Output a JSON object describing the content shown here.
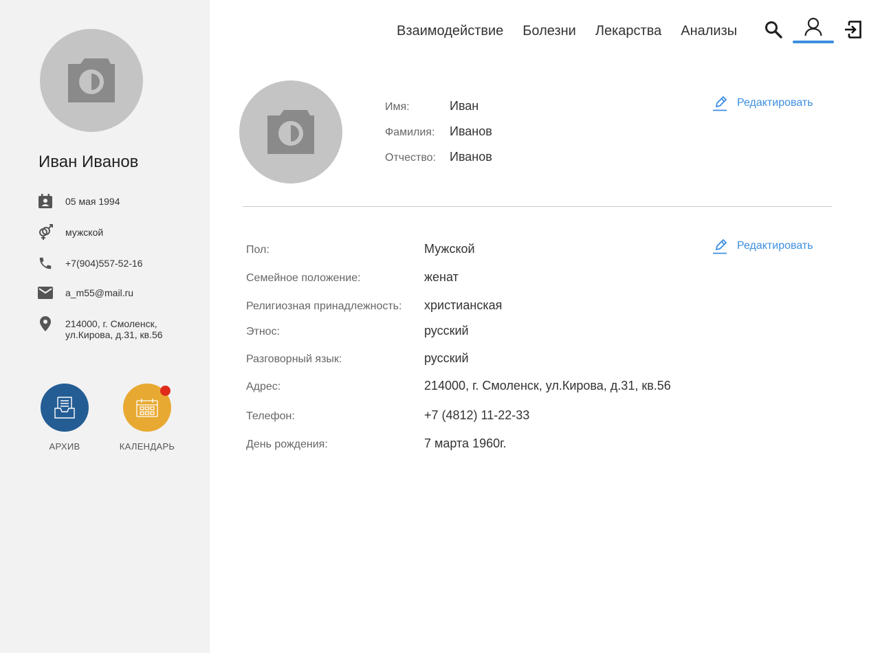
{
  "sidebar": {
    "name": "Иван Иванов",
    "birthdate": "05 мая 1994",
    "gender": "мужской",
    "phone": "+7(904)557-52-16",
    "email": "a_m55@mail.ru",
    "address_line1": "214000, г. Смоленск,",
    "address_line2": "ул.Кирова, д.31, кв.56",
    "archive_label": "АРХИВ",
    "calendar_label": "КАЛЕНДАРЬ"
  },
  "nav": {
    "items": [
      "Взаимодействие",
      "Болезни",
      "Лекарства",
      "Анализы"
    ],
    "icons": [
      "search-icon",
      "user-icon",
      "logout-icon"
    ]
  },
  "profile": {
    "fields": [
      {
        "label": "Имя:",
        "value": "Иван"
      },
      {
        "label": "Фамилия:",
        "value": "Иванов"
      },
      {
        "label": "Отчество:",
        "value": "Иванов"
      }
    ],
    "edit_label": "Редактировать"
  },
  "details": {
    "edit_label": "Редактировать",
    "rows": [
      {
        "label": "Пол:",
        "value": "Мужской"
      },
      {
        "label": "Семейное положение:",
        "value": "женат"
      },
      {
        "label": "Религиозная принадлежность:",
        "value": "христианская"
      },
      {
        "label": "Этнос:",
        "value": "русский"
      },
      {
        "label": "Разговорный язык:",
        "value": "русский"
      },
      {
        "label": "Адрес:",
        "value": "214000, г. Смоленск, ул.Кирова, д.31, кв.56"
      },
      {
        "label": "Телефон:",
        "value": "+7 (4812) 11-22-33"
      },
      {
        "label": "День рождения:",
        "value": "7 марта 1960г."
      }
    ]
  },
  "colors": {
    "sidebar_bg": "#f2f2f2",
    "accent": "#3d8ee0",
    "archive": "#245d94",
    "calendar": "#e8a932",
    "badge": "#e02b1b",
    "avatar_bg": "#c4c4c4"
  }
}
